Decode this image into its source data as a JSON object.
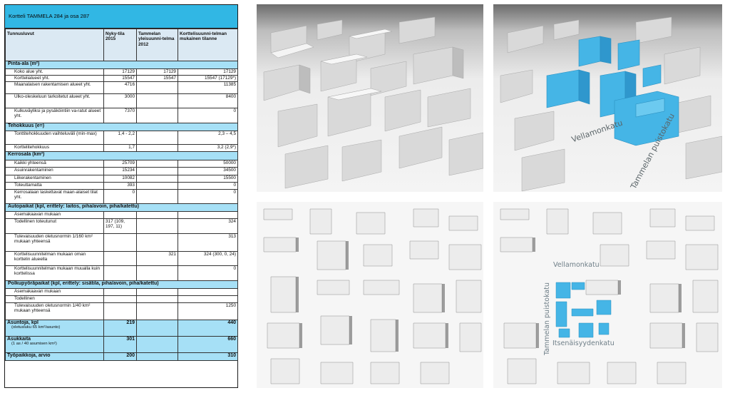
{
  "table": {
    "title": "Kortteli TAMMELA 284 ja  osa 287",
    "headers": [
      "Tunnusluvut",
      "Nyky-tila 2015",
      "Tammelan yleisuunni-telma 2012",
      "Korttelisuunni-telman mukainen tilanne"
    ],
    "sections": {
      "pinta_ala": "Pinta-ala (m²)",
      "tehokkuus": "Tehokkuus (e=)",
      "kerrosala": "Kerrosala (km²)",
      "autopaikat": "Autopaikat (kpl, erittely: laitos, piha/avoin, piha/katettu)",
      "polkupyora": "Polkupyöräpaikat (kpl, erittely: sisätila, piha/avoin, piha/katettu)"
    },
    "rows": {
      "koko_alue": [
        "Koko alue yht.",
        "17129",
        "17129",
        "17129"
      ],
      "korttelialueet": [
        "Korttelialueet yht.",
        "15547",
        "15547",
        "15547 (17129*)"
      ],
      "maanalainen": [
        "Maanalaisen rakentamisen alueet yht.",
        "4716",
        "",
        "11385"
      ],
      "ulko_oleskelu": [
        "Ulko-oleskeluun tarkoitetut alueet yht.",
        "3000",
        "",
        "8400"
      ],
      "kulkuvaylat": [
        "Kulkuväyliksi ja pysäköintiin va-ratut alueet yht.",
        "7370",
        "",
        "0"
      ],
      "tonttitehokkuus": [
        "Tonttitehokkuuden vaihteluväli (min-max)",
        "1,4 - 2,2",
        "",
        "2,3 – 4,5"
      ],
      "korttelitehokkuus": [
        "Korttelitehokkuus",
        "1,7",
        "",
        "3,2 (2,9*)"
      ],
      "kaikki_yhteensa": [
        "Kaikki yhteensä",
        "25709",
        "",
        "50000"
      ],
      "asuinrakentaminen": [
        "Asuinrakentaminen",
        "15234",
        "",
        "34500"
      ],
      "liikerakentaminen": [
        "Liikerakentaminen",
        "10082",
        "",
        "15500"
      ],
      "toteuttamatta": [
        "Toteuttamatta",
        "393",
        "",
        "0"
      ],
      "kerrosalaan": [
        "Kerrosalaan laskettavat maan-alaiset tilat yht.",
        "0",
        "",
        "0"
      ],
      "ap_asemakaava": [
        "Asemakaavan mukaan",
        "",
        "",
        ""
      ],
      "ap_todellinen": [
        "Todellinen toteutunut",
        "317 (109, 197, 11)",
        "",
        "324"
      ],
      "ap_tulevaisuus": [
        "Tulevaisuuden oletusnormin 1/160 km² mukaan yhteensä",
        "",
        "",
        "313"
      ],
      "ap_oma": [
        "Korttelisuunnitelman mukaan oman korttelin alueella",
        "",
        "321",
        "324 (300, 0, 24)"
      ],
      "ap_muualla": [
        "Korttelisuunnitelman mukaan muualla kuin korttelissa",
        "",
        "",
        "0"
      ],
      "pp_asemakaava": [
        "Asemakaavan mukaan",
        "",
        "",
        ""
      ],
      "pp_todellinen": [
        "Todellinen",
        "",
        "",
        ""
      ],
      "pp_tulevaisuus": [
        "Tulevaisuuden oletusnormin 1/40 km² mukaan yhteensä",
        "",
        "",
        "1250"
      ],
      "asuntoja": [
        "Asuntoja, kpl",
        "(oletusluku 65 km²/asunto)",
        "219",
        "",
        "440"
      ],
      "asukkaita": [
        "Asukkaita",
        "(1 as / 40 asumisen km²)",
        "301",
        "",
        "660"
      ],
      "tyopaikkoja": [
        "Työpaikkoja, arvio",
        "",
        "200",
        "",
        "310"
      ]
    }
  },
  "streets": {
    "vellamonkatu": "Vellamonkatu",
    "tammelan_puistokatu": "Tammelan puistokatu",
    "itsenaisyydenkatu": "Itsenäisyydenkatu"
  },
  "colors": {
    "header_blue": "#31b7e4",
    "section_blue": "#a6e0f6",
    "highlight_building": "#45b5e6"
  }
}
